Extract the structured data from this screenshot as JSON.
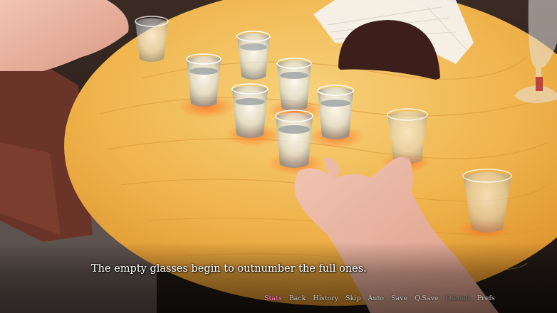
{
  "scene": {
    "description_icon": "shot-glasses-table-scene"
  },
  "dialogue": {
    "text": "The empty glasses begin to outnumber the full ones."
  },
  "quick_menu": {
    "items": [
      {
        "label": "Stats",
        "state": "active"
      },
      {
        "label": "Back",
        "state": "normal"
      },
      {
        "label": "History",
        "state": "normal"
      },
      {
        "label": "Skip",
        "state": "normal"
      },
      {
        "label": "Auto",
        "state": "normal"
      },
      {
        "label": "Save",
        "state": "normal"
      },
      {
        "label": "Q.Save",
        "state": "normal"
      },
      {
        "label": "Q.Load",
        "state": "disabled"
      },
      {
        "label": "Prefs",
        "state": "normal"
      }
    ]
  },
  "colors": {
    "active": "#ff7fd0",
    "normal": "#c8c8c8",
    "disabled": "#7a7a7a",
    "table": "#f0b544"
  }
}
